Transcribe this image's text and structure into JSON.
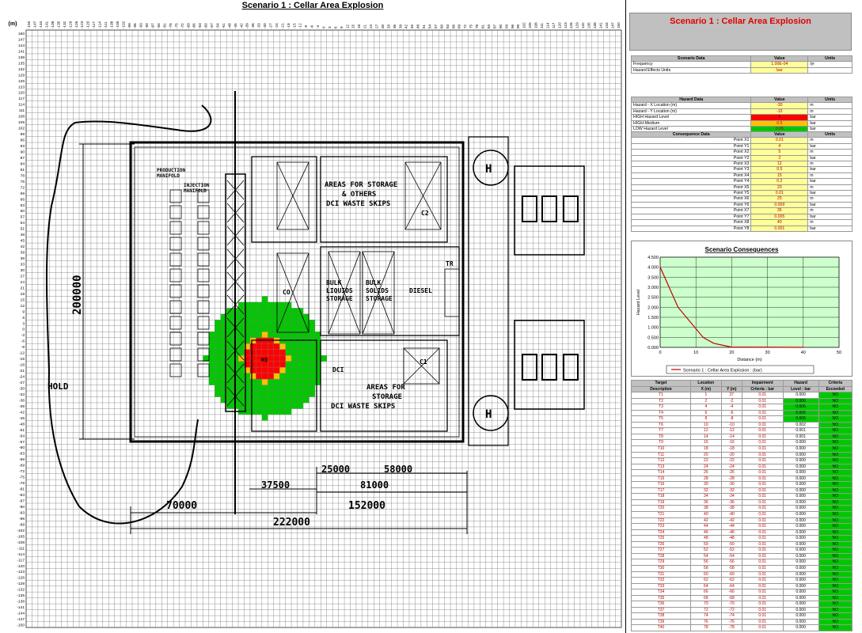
{
  "title": "Scenario 1 : Cellar Area Explosion",
  "axis_unit_label": "(m)",
  "plot_labels": {
    "hold": "HOLD",
    "dim_200000": "200000",
    "dim_37500": "37500",
    "dim_25000": "25000",
    "dim_58000": "58000",
    "dim_81000": "81000",
    "dim_70000": "70000",
    "dim_152000": "152000",
    "dim_222000": "222000",
    "areas_storage_top": [
      "AREAS FOR STORAGE",
      "& OTHERS",
      "DCI WASTE SKIPS"
    ],
    "areas_storage_bottom": [
      "AREAS FOR",
      "STORAGE",
      "DCI WASTE SKIPS"
    ],
    "bulk_liquids": [
      "BULK",
      "LIQUIDS",
      "STORAGE"
    ],
    "bulk_solids": [
      "BULK",
      "SOLIDS",
      "STORAGE"
    ],
    "diesel": "DIESEL",
    "production_manifold": [
      "PRODUCTION",
      "MANIFOLD"
    ],
    "injection_manifold": [
      "INJECTION",
      "MANIFOLD"
    ],
    "co": "CO",
    "hm": "H5",
    "helipad": "H",
    "dci": "DCI",
    "tr": "TR",
    "c1": "C1",
    "c2": "C2"
  },
  "scenario_data": {
    "header": [
      "Scenario Data",
      "Value",
      "Units"
    ],
    "rows": [
      [
        "Frequency",
        "1.00E-04",
        "/yr"
      ],
      [
        "Hazard Effects Units",
        "bar",
        ""
      ]
    ]
  },
  "hazard_data": {
    "header": [
      "Hazard Data",
      "Value",
      "Units"
    ],
    "rows": [
      [
        "Hazard  - X Location (m)",
        "-30",
        "m"
      ],
      [
        "Hazard  - Y Location (m)",
        "-15",
        "m"
      ],
      [
        "HIGH Hazard Level",
        "1",
        "bar"
      ],
      [
        "HIGH-Medium",
        "0.5",
        "bar"
      ],
      [
        "LOW Hazard Level",
        "0.05",
        "bar"
      ]
    ]
  },
  "consequence_data": {
    "header": [
      "Consequence Data",
      "Value",
      "Units"
    ],
    "rows": [
      [
        "Point X1",
        "0.01",
        "m"
      ],
      [
        "Point Y1",
        "4",
        "bar"
      ],
      [
        "Point X2",
        "5",
        "m"
      ],
      [
        "Point Y2",
        "2",
        "bar"
      ],
      [
        "Point X3",
        "12",
        "m"
      ],
      [
        "Point Y3",
        "0.5",
        "bar"
      ],
      [
        "Point X4",
        "15",
        "m"
      ],
      [
        "Point Y4",
        "0.2",
        "bar"
      ],
      [
        "Point X5",
        "20",
        "m"
      ],
      [
        "Point Y5",
        "0.01",
        "bar"
      ],
      [
        "Point X6",
        "25",
        "m"
      ],
      [
        "Point Y6",
        "0.009",
        "bar"
      ],
      [
        "Point X7",
        "35",
        "m"
      ],
      [
        "Point Y7",
        "0.005",
        "bar"
      ],
      [
        "Point X8",
        "40",
        "m"
      ],
      [
        "Point Y8",
        "0.001",
        "bar"
      ]
    ]
  },
  "chart_data": [
    {
      "type": "heatmap",
      "title": "Scenario 1 : Cellar Area Explosion",
      "xlabel": "(m)",
      "ylabel": "(m)",
      "xlim": [
        -150,
        150
      ],
      "ylim": [
        -150,
        150
      ],
      "x_ticks_step": 3,
      "y_ticks_step": 3,
      "hazard_center": [
        -30,
        -15
      ],
      "zones": [
        {
          "level": "LOW",
          "threshold": 0.05,
          "color": "#00c800",
          "radius_m": 30
        },
        {
          "level": "HIGH-Medium",
          "threshold": 0.5,
          "color": "#ffc000",
          "radius_m": 12
        },
        {
          "level": "HIGH",
          "threshold": 1,
          "color": "#ff0000",
          "radius_m": 10
        }
      ]
    },
    {
      "type": "line",
      "title": "Scenario Consequences",
      "xlabel": "Distance (m)",
      "ylabel": "Hazard Level",
      "xlim": [
        0,
        50
      ],
      "ylim": [
        0,
        4.5
      ],
      "x_ticks": [
        0,
        10,
        20,
        30,
        40,
        50
      ],
      "y_ticks": [
        "0.000",
        "0.500",
        "1.000",
        "1.500",
        "2.000",
        "2.500",
        "3.000",
        "3.500",
        "4.000",
        "4.500"
      ],
      "legend": "Scenario 1 : Cellar Area Explosion : (bar)",
      "series": [
        {
          "name": "Scenario 1 : Cellar Area Explosion : (bar)",
          "color": "#c00000",
          "x": [
            0.01,
            5,
            12,
            15,
            20,
            25,
            35,
            40
          ],
          "y": [
            4,
            2,
            0.5,
            0.2,
            0.01,
            0.009,
            0.005,
            0.001
          ]
        }
      ]
    }
  ],
  "targets": {
    "header1": [
      "Target",
      "Location",
      "",
      "Impairment",
      "Hazard",
      "Criteria"
    ],
    "header2": [
      "Description",
      "X (m)",
      "Y (m)",
      "Criteria : bar",
      "Level : bar",
      "Exceeded"
    ],
    "rows": [
      [
        "T1",
        "1",
        "37",
        "0.01",
        "0.000",
        "NO"
      ],
      [
        "T2",
        "2",
        "-2",
        "0.01",
        "0.006",
        "NO"
      ],
      [
        "T3",
        "4",
        "-4",
        "0.01",
        "0.006",
        "NO"
      ],
      [
        "T4",
        "6",
        "-6",
        "0.01",
        "0.005",
        "NO"
      ],
      [
        "T5",
        "8",
        "-8",
        "0.01",
        "0.005",
        "NO"
      ],
      [
        "T6",
        "10",
        "-10",
        "0.01",
        "0.002",
        "NO"
      ],
      [
        "T7",
        "12",
        "-12",
        "0.01",
        "0.001",
        "NO"
      ],
      [
        "T8",
        "14",
        "-14",
        "0.01",
        "0.001",
        "NO"
      ],
      [
        "T9",
        "16",
        "-16",
        "0.01",
        "0.000",
        "NO"
      ],
      [
        "T10",
        "18",
        "-18",
        "0.01",
        "0.000",
        "NO"
      ],
      [
        "T11",
        "20",
        "-20",
        "0.01",
        "0.000",
        "NO"
      ],
      [
        "T12",
        "22",
        "-22",
        "0.01",
        "0.000",
        "NO"
      ],
      [
        "T13",
        "24",
        "-24",
        "0.01",
        "0.000",
        "NO"
      ],
      [
        "T14",
        "26",
        "-26",
        "0.01",
        "0.000",
        "NO"
      ],
      [
        "T15",
        "28",
        "-28",
        "0.01",
        "0.000",
        "NO"
      ],
      [
        "T16",
        "30",
        "-30",
        "0.01",
        "0.000",
        "NO"
      ],
      [
        "T17",
        "32",
        "-32",
        "0.01",
        "0.000",
        "NO"
      ],
      [
        "T18",
        "34",
        "-34",
        "0.01",
        "0.000",
        "NO"
      ],
      [
        "T19",
        "36",
        "-36",
        "0.01",
        "0.000",
        "NO"
      ],
      [
        "T20",
        "38",
        "-38",
        "0.01",
        "0.000",
        "NO"
      ],
      [
        "T21",
        "40",
        "-40",
        "0.01",
        "0.000",
        "NO"
      ],
      [
        "T22",
        "42",
        "-42",
        "0.01",
        "0.000",
        "NO"
      ],
      [
        "T23",
        "44",
        "-44",
        "0.01",
        "0.000",
        "NO"
      ],
      [
        "T24",
        "46",
        "-46",
        "0.01",
        "0.000",
        "NO"
      ],
      [
        "T25",
        "48",
        "-48",
        "0.01",
        "0.000",
        "NO"
      ],
      [
        "T26",
        "50",
        "-50",
        "0.01",
        "0.000",
        "NO"
      ],
      [
        "T27",
        "52",
        "-52",
        "0.01",
        "0.000",
        "NO"
      ],
      [
        "T28",
        "54",
        "-54",
        "0.01",
        "0.000",
        "NO"
      ],
      [
        "T29",
        "56",
        "-56",
        "0.01",
        "0.000",
        "NO"
      ],
      [
        "T30",
        "58",
        "-58",
        "0.01",
        "0.000",
        "NO"
      ],
      [
        "T31",
        "60",
        "-60",
        "0.01",
        "0.000",
        "NO"
      ],
      [
        "T32",
        "62",
        "-62",
        "0.01",
        "0.000",
        "NO"
      ],
      [
        "T33",
        "64",
        "-64",
        "0.01",
        "0.000",
        "NO"
      ],
      [
        "T34",
        "66",
        "-66",
        "0.01",
        "0.000",
        "NO"
      ],
      [
        "T35",
        "68",
        "-68",
        "0.01",
        "0.000",
        "NO"
      ],
      [
        "T36",
        "70",
        "-70",
        "0.01",
        "0.000",
        "NO"
      ],
      [
        "T37",
        "72",
        "-72",
        "0.01",
        "0.000",
        "NO"
      ],
      [
        "T38",
        "74",
        "-74",
        "0.01",
        "0.000",
        "NO"
      ],
      [
        "T39",
        "76",
        "-76",
        "0.01",
        "0.000",
        "NO"
      ],
      [
        "T40",
        "78",
        "-78",
        "0.01",
        "0.000",
        "NO"
      ]
    ]
  }
}
